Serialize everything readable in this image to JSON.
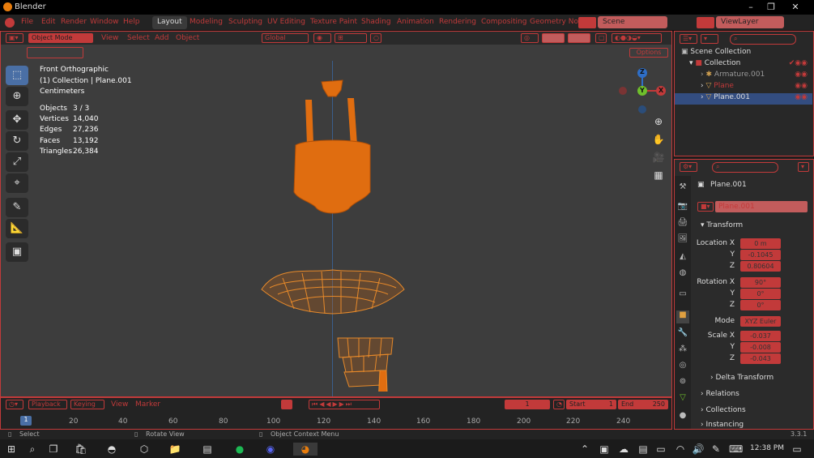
{
  "app": {
    "title": "Blender",
    "version": "3.3.1"
  },
  "menu": [
    "File",
    "Edit",
    "Render",
    "Window",
    "Help"
  ],
  "workspaces": [
    "Layout",
    "Modeling",
    "Sculpting",
    "UV Editing",
    "Texture Paint",
    "Shading",
    "Animation",
    "Rendering",
    "Compositing",
    "Geometry Nod"
  ],
  "active_workspace": "Layout",
  "scene": "Scene",
  "view_layer": "ViewLayer",
  "viewport_header": {
    "mode": "Object Mode",
    "view": "View",
    "select": "Select",
    "add": "Add",
    "object": "Object",
    "transform": "Global",
    "options": "Options"
  },
  "viewport_info": {
    "view_name": "Front Orthographic",
    "collection_path": "(1) Collection | Plane.001",
    "units": "Centimeters",
    "stats": [
      {
        "label": "Objects",
        "value": "3 / 3"
      },
      {
        "label": "Vertices",
        "value": "14,040"
      },
      {
        "label": "Edges",
        "value": "27,236"
      },
      {
        "label": "Faces",
        "value": "13,192"
      },
      {
        "label": "Triangles",
        "value": "26,384"
      }
    ]
  },
  "gizmo": {
    "x": "X",
    "y": "Y",
    "z": "Z"
  },
  "timeline": {
    "playback": "Playback",
    "keying": "Keying",
    "view": "View",
    "marker": "Marker",
    "current_frame": "1",
    "start_label": "Start",
    "start": "1",
    "end_label": "End",
    "end": "250",
    "ticks": [
      "20",
      "40",
      "60",
      "80",
      "100",
      "120",
      "140",
      "160",
      "180",
      "200",
      "220",
      "240"
    ],
    "playhead": "1"
  },
  "statusbar": {
    "select": "Select",
    "rotate": "Rotate View",
    "context": "Object Context Menu",
    "version": "3.3.1"
  },
  "outliner": {
    "root": "Scene Collection",
    "collection": "Collection",
    "items": [
      "Armature.001",
      "Plane",
      "Plane.001"
    ]
  },
  "properties": {
    "object_name": "Plane.001",
    "data_name": "Plane.001",
    "transform_title": "Transform",
    "location_label": "Location X",
    "location": [
      "0 m",
      "-0.1045",
      "0.80604"
    ],
    "rotation_label": "Rotation X",
    "rotation": [
      "90°",
      "0°",
      "0°"
    ],
    "mode_label": "Mode",
    "mode": "XYZ Euler",
    "scale_label": "Scale X",
    "scale": [
      "-0.037",
      "-0.008",
      "-0.043"
    ],
    "axis_y": "Y",
    "axis_z": "Z",
    "sections": [
      "Delta Transform",
      "Relations",
      "Collections",
      "Instancing"
    ]
  },
  "taskbar": {
    "time": "12:38 PM"
  },
  "colors": {
    "accent_red": "#c23a3a",
    "mesh_orange": "#e06d10",
    "selection_blue": "#334d80",
    "viewport_bg": "#3d3d3d"
  }
}
